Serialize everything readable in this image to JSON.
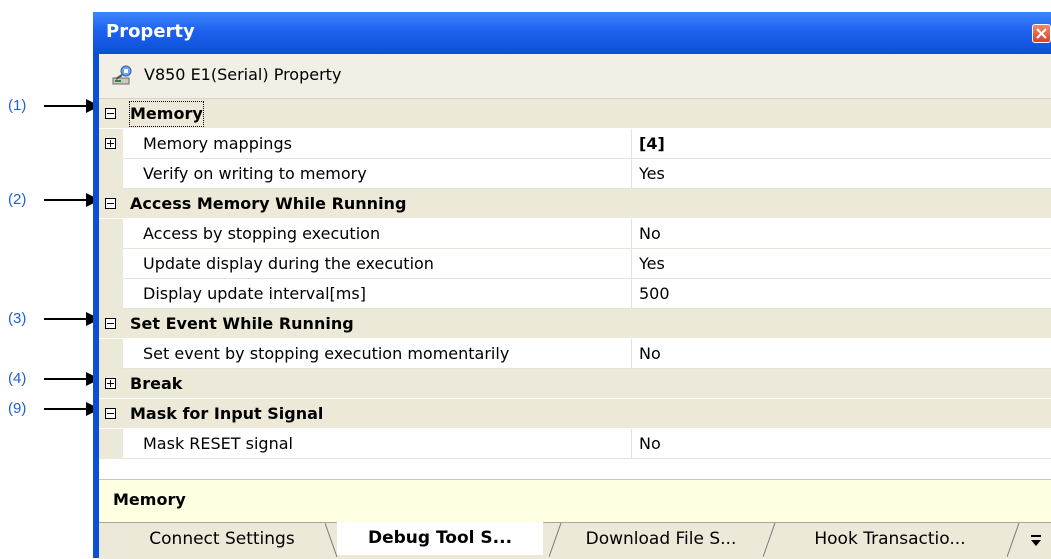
{
  "callouts": [
    "(1)",
    "(2)",
    "(3)",
    "(4)",
    "(9)"
  ],
  "window": {
    "title": "Property",
    "close_icon": "close-icon",
    "header_icon": "property-wrench-icon",
    "header_text": "V850 E1(Serial) Property"
  },
  "grid": {
    "rows": [
      {
        "kind": "category",
        "expander": "minus",
        "name": "Memory"
      },
      {
        "kind": "property",
        "expander": "plus",
        "name": "Memory mappings",
        "value": "[4]",
        "value_bold": true
      },
      {
        "kind": "property",
        "expander": "none",
        "name": "Verify on writing to memory",
        "value": "Yes"
      },
      {
        "kind": "category",
        "expander": "minus",
        "name": "Access Memory While Running"
      },
      {
        "kind": "property",
        "expander": "none",
        "name": "Access by stopping execution",
        "value": "No"
      },
      {
        "kind": "property",
        "expander": "none",
        "name": "Update display during the execution",
        "value": "Yes"
      },
      {
        "kind": "property",
        "expander": "none",
        "name": "Display update interval[ms]",
        "value": "500"
      },
      {
        "kind": "category",
        "expander": "minus",
        "name": "Set Event While Running"
      },
      {
        "kind": "property",
        "expander": "none",
        "name": "Set event by stopping execution momentarily",
        "value": "No"
      },
      {
        "kind": "category",
        "expander": "plus",
        "name": "Break"
      },
      {
        "kind": "category",
        "expander": "minus",
        "name": "Mask for Input Signal"
      },
      {
        "kind": "property",
        "expander": "none",
        "name": "Mask RESET signal",
        "value": "No"
      }
    ]
  },
  "description": "Memory",
  "tabs": [
    "Connect Settings",
    "Debug Tool S...",
    "Download File S...",
    "Hook Transactio..."
  ],
  "active_tab": 1,
  "colors": {
    "titlebar": "#1d62ee",
    "category_bg": "#ece9d8",
    "description_bg": "#ffffe1",
    "callout_text": "#1f5fd6"
  }
}
